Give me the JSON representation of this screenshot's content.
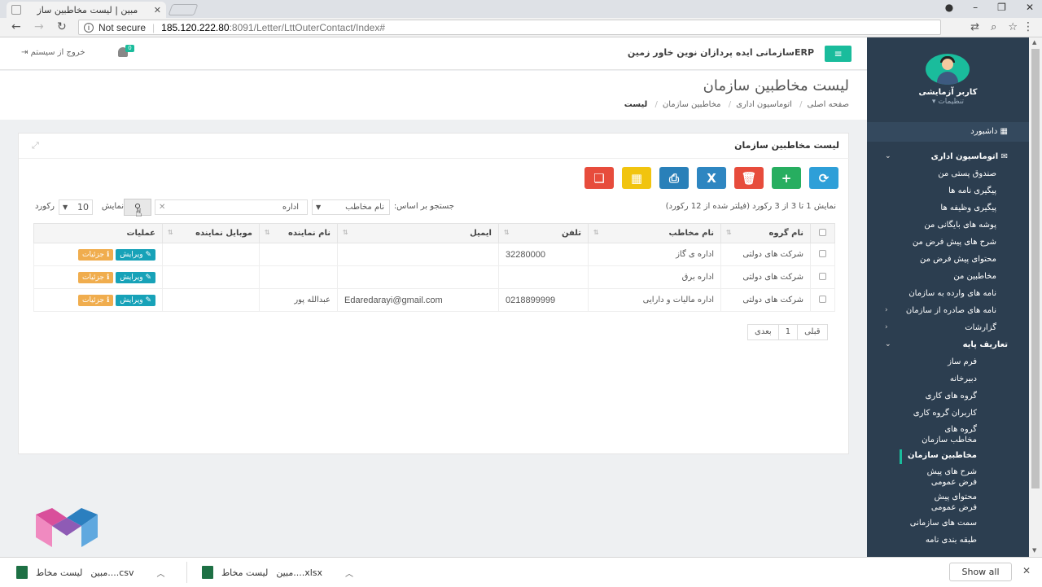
{
  "browser": {
    "tab_title": "مبین | لیست مخاطبین ساز",
    "security": "Not secure",
    "url_host": "185.120.222.80",
    "url_path": ":8091/Letter/LttOuterContact/Index#"
  },
  "topbar": {
    "company": "ERPسازمانی ایده پردازان نوین خاور زمین",
    "logout": "خروج از سیستم",
    "bell_count": "0"
  },
  "sidebar": {
    "user_name": "کاربر آزمایشی",
    "user_settings": "تنظیمات",
    "dashboard": "داشبورد",
    "group1": "اتوماسیون اداری",
    "items1": [
      "صندوق پستی من",
      "پیگیری نامه ها",
      "پیگیری وظیفه ها",
      "پوشه های بایگانی من",
      "شرح های پیش فرض من",
      "محتوای پیش فرض من",
      "مخاطبین من",
      "نامه های وارده به سازمان",
      "نامه های صادره از سازمان",
      "گزارشات"
    ],
    "group2": "تعاریف پایه",
    "items2": [
      "فرم ساز",
      "دبیرخانه",
      "گروه های کاری",
      "کاربران گروه کاری",
      "گروه های مخاطب سازمان",
      "مخاطبین سازمان",
      "شرح های پیش فرض عمومی",
      "محتوای پیش فرض عمومی",
      "سمت های سازمانی",
      "طبقه بندی نامه"
    ]
  },
  "page": {
    "title": "لیست مخاطبین سازمان",
    "breadcrumb": [
      "صفحه اصلی",
      "اتوماسیون اداری",
      "مخاطبین سازمان",
      "لیست"
    ],
    "panel_title": "لیست مخاطبین سازمان"
  },
  "toolbar": {
    "colors": [
      "#e74c3c",
      "#f1c40f",
      "#2980b9",
      "#2980b9",
      "#e74c3c",
      "#27ae60",
      "#2e9fd8"
    ]
  },
  "search": {
    "info": "نمایش 1 تا 3 از 3 رکورد (فیلتر شده از 12 رکورد)",
    "by_label": "جستجو بر اساس:",
    "field": "نام مخاطب",
    "query": "اداره",
    "show_label": "نمایش",
    "page_size": "10",
    "records_label": "رکورد"
  },
  "table": {
    "columns": [
      "نام گروه",
      "نام مخاطب",
      "تلفن",
      "ایمیل",
      "نام نماینده",
      "موبایل نماینده",
      "عملیات"
    ],
    "rows": [
      {
        "group": "شرکت های دولتی",
        "name": "اداره ی گاز",
        "phone": "32280000",
        "email": "",
        "rep": "",
        "mobile": ""
      },
      {
        "group": "شرکت های دولتی",
        "name": "اداره برق",
        "phone": "",
        "email": "",
        "rep": "",
        "mobile": ""
      },
      {
        "group": "شرکت های دولتی",
        "name": "اداره مالیات و دارایی",
        "phone": "0218899999",
        "email": "Edaredarayi@gmail.com",
        "rep": "عبدالله پور",
        "mobile": ""
      }
    ],
    "edit_label": "ویرایش",
    "details_label": "جزئیات"
  },
  "pager": {
    "prev": "قبلی",
    "page": "1",
    "next": "بعدی"
  },
  "downloads": {
    "file1_name": "لیست مخاط",
    "file1_ext": "مبین....csv",
    "file2_name": "لیست مخاط",
    "file2_ext": "مبین....xlsx",
    "show_all": "Show all"
  }
}
